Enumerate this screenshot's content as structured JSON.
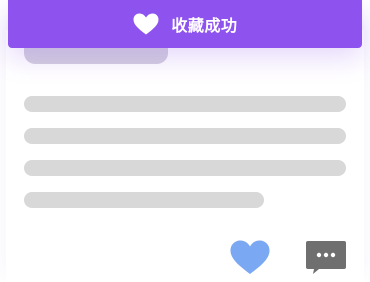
{
  "toast": {
    "message": "收藏成功",
    "icon": "heart-icon",
    "background_color": "#8e52ef"
  },
  "content": {
    "placeholder_color": "#d8d8d8",
    "title_placeholder_color": "#d3cfde"
  },
  "actions": {
    "like": {
      "icon": "heart-icon",
      "color": "#7aa8f2"
    },
    "comment": {
      "icon": "comment-bubble-icon",
      "color": "#6f6f6f"
    }
  }
}
